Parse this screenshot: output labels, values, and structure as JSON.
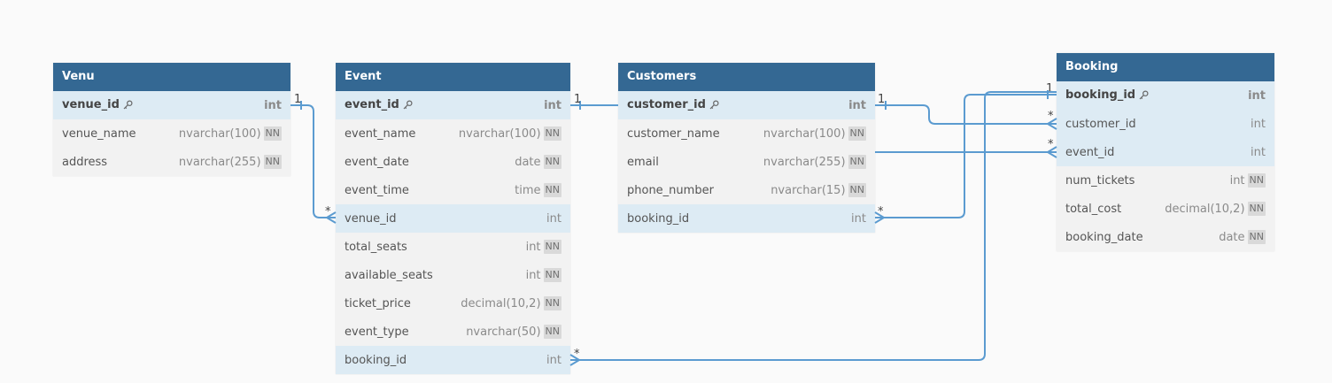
{
  "colors": {
    "header": "#346893",
    "header_text": "#ffffff",
    "row_bg": "#f2f2f2",
    "key_row_bg": "#ddebf4",
    "relation_line": "#5b9bd0",
    "canvas": "#fafafa"
  },
  "tables": [
    {
      "id": "venu",
      "name": "Venu",
      "columns": [
        {
          "name": "venue_id",
          "type": "int",
          "nn": "",
          "pk": true,
          "key": true
        },
        {
          "name": "venue_name",
          "type": "nvarchar(100)",
          "nn": "NN",
          "pk": false,
          "key": false
        },
        {
          "name": "address",
          "type": "nvarchar(255)",
          "nn": "NN",
          "pk": false,
          "key": false
        }
      ]
    },
    {
      "id": "event",
      "name": "Event",
      "columns": [
        {
          "name": "event_id",
          "type": "int",
          "nn": "",
          "pk": true,
          "key": true
        },
        {
          "name": "event_name",
          "type": "nvarchar(100)",
          "nn": "NN",
          "pk": false,
          "key": false
        },
        {
          "name": "event_date",
          "type": "date",
          "nn": "NN",
          "pk": false,
          "key": false
        },
        {
          "name": "event_time",
          "type": "time",
          "nn": "NN",
          "pk": false,
          "key": false
        },
        {
          "name": "venue_id",
          "type": "int",
          "nn": "",
          "pk": false,
          "key": true
        },
        {
          "name": "total_seats",
          "type": "int",
          "nn": "NN",
          "pk": false,
          "key": false
        },
        {
          "name": "available_seats",
          "type": "int",
          "nn": "NN",
          "pk": false,
          "key": false
        },
        {
          "name": "ticket_price",
          "type": "decimal(10,2)",
          "nn": "NN",
          "pk": false,
          "key": false
        },
        {
          "name": "event_type",
          "type": "nvarchar(50)",
          "nn": "NN",
          "pk": false,
          "key": false
        },
        {
          "name": "booking_id",
          "type": "int",
          "nn": "",
          "pk": false,
          "key": true
        }
      ]
    },
    {
      "id": "customers",
      "name": "Customers",
      "columns": [
        {
          "name": "customer_id",
          "type": "int",
          "nn": "",
          "pk": true,
          "key": true
        },
        {
          "name": "customer_name",
          "type": "nvarchar(100)",
          "nn": "NN",
          "pk": false,
          "key": false
        },
        {
          "name": "email",
          "type": "nvarchar(255)",
          "nn": "NN",
          "pk": false,
          "key": false
        },
        {
          "name": "phone_number",
          "type": "nvarchar(15)",
          "nn": "NN",
          "pk": false,
          "key": false
        },
        {
          "name": "booking_id",
          "type": "int",
          "nn": "",
          "pk": false,
          "key": true
        }
      ]
    },
    {
      "id": "booking",
      "name": "Booking",
      "columns": [
        {
          "name": "booking_id",
          "type": "int",
          "nn": "",
          "pk": true,
          "key": true
        },
        {
          "name": "customer_id",
          "type": "int",
          "nn": "",
          "pk": false,
          "key": true
        },
        {
          "name": "event_id",
          "type": "int",
          "nn": "",
          "pk": false,
          "key": true
        },
        {
          "name": "num_tickets",
          "type": "int",
          "nn": "NN",
          "pk": false,
          "key": false
        },
        {
          "name": "total_cost",
          "type": "decimal(10,2)",
          "nn": "NN",
          "pk": false,
          "key": false
        },
        {
          "name": "booking_date",
          "type": "date",
          "nn": "NN",
          "pk": false,
          "key": false
        }
      ]
    }
  ],
  "relations": [
    {
      "id": "venu-event",
      "from_card": "1",
      "to_card": "*"
    },
    {
      "id": "event-customers",
      "from_card": "1",
      "to_card": ""
    },
    {
      "id": "customers-booking",
      "from_card": "1",
      "to_card": "*"
    },
    {
      "id": "booking-customers",
      "from_card": "1",
      "to_card": "*"
    },
    {
      "id": "customers-email-booking",
      "from_card": "",
      "to_card": "*"
    },
    {
      "id": "event-booking",
      "from_card": "",
      "to_card": "*"
    }
  ]
}
